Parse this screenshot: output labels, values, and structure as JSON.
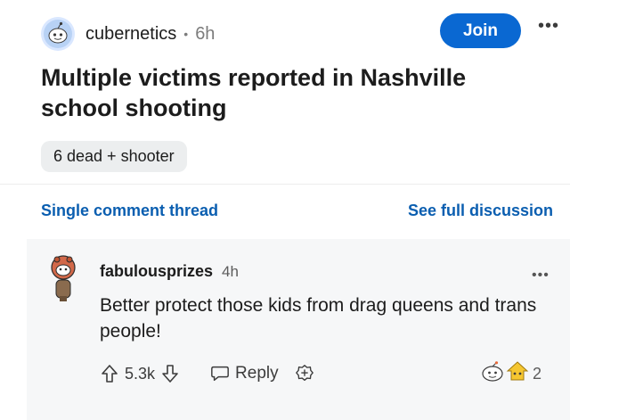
{
  "post": {
    "subreddit": "cubernetics",
    "separator": "•",
    "time": "6h",
    "join_label": "Join",
    "more": "•••",
    "title": "Multiple victims reported in Nashville school shooting",
    "flair": "6 dead + shooter"
  },
  "thread_links": {
    "single": "Single comment thread",
    "full": "See full discussion"
  },
  "comment": {
    "username": "fabulousprizes",
    "time": "4h",
    "more": "•••",
    "body": "Better protect those kids from drag queens and trans people!",
    "votes": "5.3k",
    "reply_label": "Reply",
    "award_count": "2"
  },
  "colors": {
    "join_bg": "#0a68d2",
    "link": "#0a5eb0",
    "comment_bg": "#f6f7f8",
    "flair_bg": "#eceeef"
  }
}
